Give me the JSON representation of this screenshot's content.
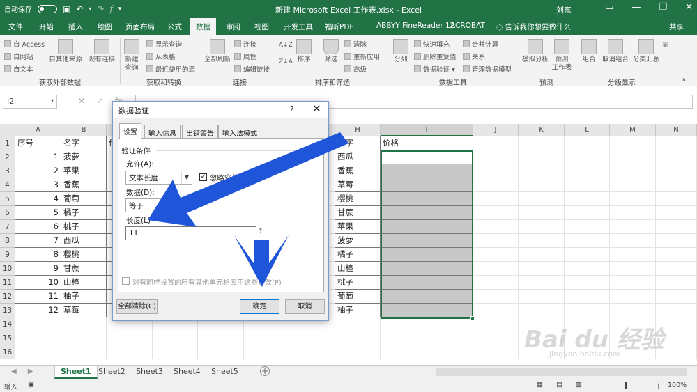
{
  "titlebar": {
    "autosave": "自动保存",
    "title": "新建 Microsoft Excel 工作表.xlsx  -  Excel",
    "user": "刘东",
    "minimize": "—",
    "restore": "❐",
    "close": "✕"
  },
  "tabs": [
    {
      "label": "文件"
    },
    {
      "label": "开始"
    },
    {
      "label": "插入"
    },
    {
      "label": "绘图"
    },
    {
      "label": "页面布局"
    },
    {
      "label": "公式"
    },
    {
      "label": "数据"
    },
    {
      "label": "审阅"
    },
    {
      "label": "视图"
    },
    {
      "label": "开发工具"
    },
    {
      "label": "福昕PDF"
    },
    {
      "label": "ABBYY FineReader 12"
    },
    {
      "label": "ACROBAT"
    },
    {
      "label": "告诉我你想要做什么"
    },
    {
      "label": "共享"
    }
  ],
  "ribbon": {
    "from_access": "自 Access",
    "from_web": "自网站",
    "from_text": "自文本",
    "from_other": "自其他来源",
    "existing_conn": "现有连接",
    "new_query": "新建\n查询",
    "show_queries": "显示查询",
    "from_table": "从表格",
    "recent_sources": "最近使用的源",
    "refresh_all": "全部刷新",
    "connections": "连接",
    "properties": "属性",
    "edit_links": "编辑链接",
    "sort": "排序",
    "filter": "筛选",
    "clear": "清除",
    "reapply": "重新应用",
    "advanced": "高级",
    "text_to_columns": "分列",
    "flash_fill": "快速填充",
    "remove_dup": "删除重复值",
    "data_validation": "数据验证",
    "consolidate": "合并计算",
    "relationships": "关系",
    "data_model": "管理数据模型",
    "what_if": "模拟分析",
    "forecast_sheet": "预测\n工作表",
    "group": "组合",
    "ungroup": "取消组合",
    "subtotal": "分类汇总",
    "groups": {
      "get_external": "获取外部数据",
      "get_transform": "获取和转换",
      "connections": "连接",
      "sort_filter": "排序和筛选",
      "data_tools": "数据工具",
      "forecast": "预测",
      "outline": "分级显示"
    }
  },
  "formula_bar": {
    "name_box": "I2",
    "cancel": "✕",
    "enter": "✓",
    "fx": "fx"
  },
  "grid": {
    "columns": [
      "A",
      "B",
      "C",
      "D",
      "E",
      "F",
      "G",
      "H",
      "I",
      "J",
      "K",
      "L",
      "M",
      "N"
    ],
    "rows": [
      "1",
      "2",
      "3",
      "4",
      "5",
      "6",
      "7",
      "8",
      "9",
      "10",
      "11",
      "12",
      "13",
      "14",
      "15",
      "16"
    ],
    "a_header": "序号",
    "b_header": "名字",
    "c_fragment": "价",
    "h_fragment": "名字",
    "i_header": "价格",
    "a_values": [
      "1",
      "2",
      "3",
      "4",
      "5",
      "6",
      "7",
      "8",
      "9",
      "10",
      "11",
      "12"
    ],
    "b_values": [
      "菠萝",
      "苹果",
      "香蕉",
      "葡萄",
      "橘子",
      "桃子",
      "西瓜",
      "樱桃",
      "甘蔗",
      "山楂",
      "柚子",
      "草莓"
    ],
    "h_values": [
      "西瓜",
      "香蕉",
      "草莓",
      "樱桃",
      "甘蔗",
      "苹果",
      "菠萝",
      "橘子",
      "山楂",
      "桃子",
      "葡萄",
      "柚子"
    ]
  },
  "sheets": {
    "tabs": [
      "Sheet1",
      "Sheet2",
      "Sheet3",
      "Sheet4",
      "Sheet5"
    ],
    "add": "+"
  },
  "statusbar": {
    "mode": "输入",
    "zoom": "100%",
    "zoom_minus": "－",
    "zoom_plus": "＋"
  },
  "dialog": {
    "title": "数据验证",
    "help": "?",
    "close": "✕",
    "tabs": [
      "设置",
      "输入信息",
      "出错警告",
      "输入法模式"
    ],
    "section": "验证条件",
    "allow_label": "允许(A):",
    "allow_value": "文本长度",
    "ignore_blank": "忽略空值(B)",
    "data_label": "数据(D):",
    "data_value": "等于",
    "length_label": "长度(L)",
    "length_value": "11",
    "apply_all": "对有同样设置的所有其他单元格应用这些更改(P)",
    "clear_all": "全部清除(C)",
    "ok": "确定",
    "cancel": "取消"
  },
  "watermark": {
    "brand": "Bai du 经验",
    "url": "jingyan.baidu.com"
  },
  "colors": {
    "excel_green": "#217346",
    "annotation_blue": "#1f55d8",
    "locked_cell": "#c8c8c8"
  }
}
